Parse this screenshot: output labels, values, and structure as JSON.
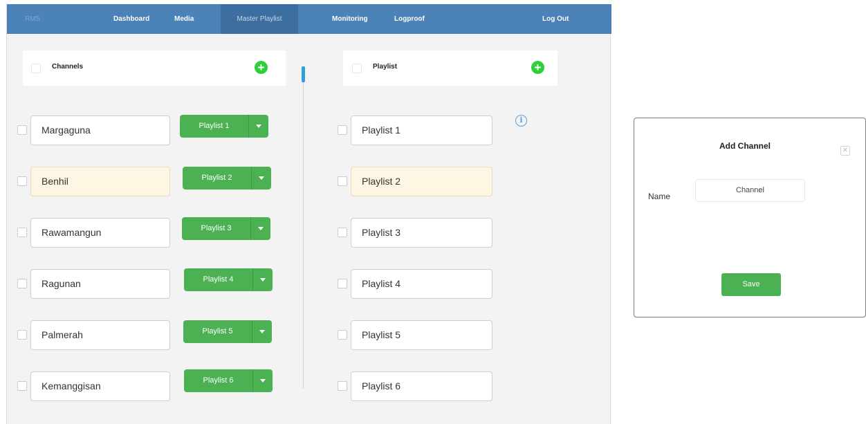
{
  "navbar": {
    "brand": "RMS",
    "items": [
      {
        "label": "Dashboard"
      },
      {
        "label": "Media"
      },
      {
        "label": "Master Playlist",
        "active": true
      },
      {
        "label": "Monitoring"
      },
      {
        "label": "Logproof"
      }
    ],
    "logout": "Log Out"
  },
  "channels_panel": {
    "header": "Channels",
    "rows": [
      {
        "name": "Margaguna",
        "playlist": "Playlist 1"
      },
      {
        "name": "Benhil",
        "playlist": "Playlist 2",
        "highlighted": true
      },
      {
        "name": "Rawamangun",
        "playlist": "Playlist 3"
      },
      {
        "name": "Ragunan",
        "playlist": "Playlist 4"
      },
      {
        "name": "Palmerah",
        "playlist": "Playlist 5"
      },
      {
        "name": "Kemanggisan",
        "playlist": "Playlist 6"
      }
    ]
  },
  "playlist_panel": {
    "header": "Playlist",
    "rows": [
      {
        "name": "Playlist 1"
      },
      {
        "name": "Playlist 2",
        "highlighted": true
      },
      {
        "name": "Playlist 3"
      },
      {
        "name": "Playlist 4"
      },
      {
        "name": "Playlist 5"
      },
      {
        "name": "Playlist 6"
      }
    ]
  },
  "dialog": {
    "title": "Add Channel",
    "name_label": "Name",
    "name_value": "Channel",
    "save_label": "Save"
  },
  "colors": {
    "navbar": "#4b82b8",
    "navbar_active": "#3c6e9f",
    "button_green": "#4cb153",
    "add_green": "#2fcf3c",
    "highlight": "#fcf6e3",
    "info_blue": "#5d9ad8",
    "scroll_blue": "#2f9fdc"
  },
  "icons": {
    "add": "plus-circle-icon",
    "info": "info-icon",
    "dropdown": "caret-down-icon",
    "close": "close-icon"
  }
}
